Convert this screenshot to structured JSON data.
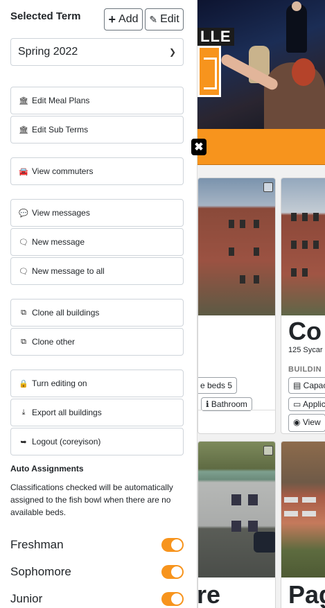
{
  "sidebar": {
    "title": "Selected Term",
    "add_label": "Add",
    "edit_label": "Edit",
    "term_value": "Spring 2022",
    "buttons": {
      "edit_meal_plans": "Edit Meal Plans",
      "edit_sub_terms": "Edit Sub Terms",
      "view_commuters": "View commuters",
      "view_messages": "View messages",
      "new_message": "New message",
      "new_message_all": "New message to all",
      "clone_all_buildings": "Clone all buildings",
      "clone_other": "Clone other",
      "turn_editing_on": "Turn editing on",
      "export_all_buildings": "Export all buildings",
      "logout": "Logout (coreyison)"
    },
    "auto_assignments": {
      "title": "Auto Assignments",
      "description": "Classifications checked will be automatically assigned to the fish bowl when there are no available beds.",
      "classifications": [
        {
          "label": "Freshman",
          "enabled": true
        },
        {
          "label": "Sophomore",
          "enabled": true
        },
        {
          "label": "Junior",
          "enabled": true
        }
      ]
    }
  },
  "background": {
    "hero_logo_text": "LLE",
    "card1_pill_beds": "e beds 5",
    "card1_pill_bathroom": "Bathroom",
    "card2_title": "Co",
    "card2_address": "125 Sycar",
    "card2_category": "BUILDIN",
    "card2_pill_capacity": "Capac",
    "card2_pill_appli": "Applic",
    "card2_view": "View",
    "card3_title": "re",
    "card4_title": "Pag"
  },
  "colors": {
    "accent": "#f7941d",
    "close_button": "#000000"
  },
  "icons": {
    "add": "plus-icon",
    "edit": "pencil-icon",
    "meal": "bank-icon",
    "car": "car-icon",
    "comments": "comments-icon",
    "comment": "comment-icon",
    "clone": "clone-icon",
    "lock": "lock-icon",
    "download": "download-icon",
    "logout": "sign-out-icon",
    "close": "close-icon"
  }
}
